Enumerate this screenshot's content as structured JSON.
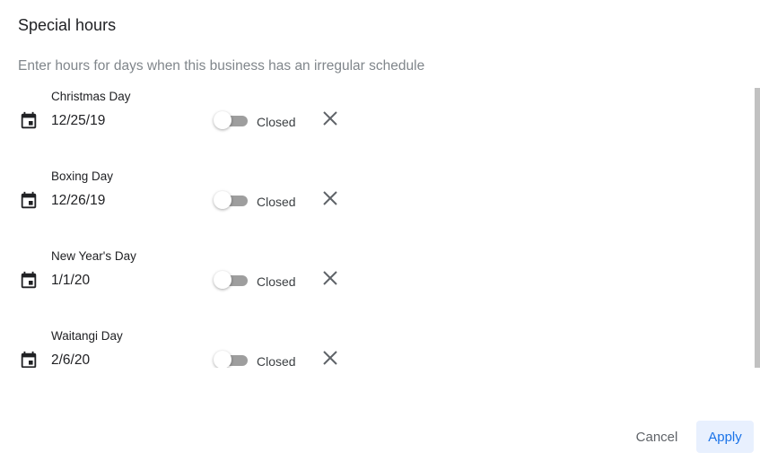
{
  "dialog": {
    "title": "Special hours",
    "subtitle": "Enter hours for days when this business has an irregular schedule"
  },
  "special_days": [
    {
      "name": "Christmas Day",
      "date": "12/25/19",
      "status": "Closed",
      "open": false,
      "icon": "calendar-icon"
    },
    {
      "name": "Boxing Day",
      "date": "12/26/19",
      "status": "Closed",
      "open": false,
      "icon": "calendar-icon"
    },
    {
      "name": "New Year's Day",
      "date": "1/1/20",
      "status": "Closed",
      "open": false,
      "icon": "calendar-icon"
    },
    {
      "name": "Waitangi Day",
      "date": "2/6/20",
      "status": "Closed",
      "open": false,
      "icon": "calendar-icon"
    }
  ],
  "footer": {
    "cancel_label": "Cancel",
    "apply_label": "Apply"
  },
  "colors": {
    "primary": "#1a73e8",
    "apply_bg": "#e8f0fe",
    "toggle_track_off": "#9e9e9e",
    "text_secondary": "#80868b"
  }
}
